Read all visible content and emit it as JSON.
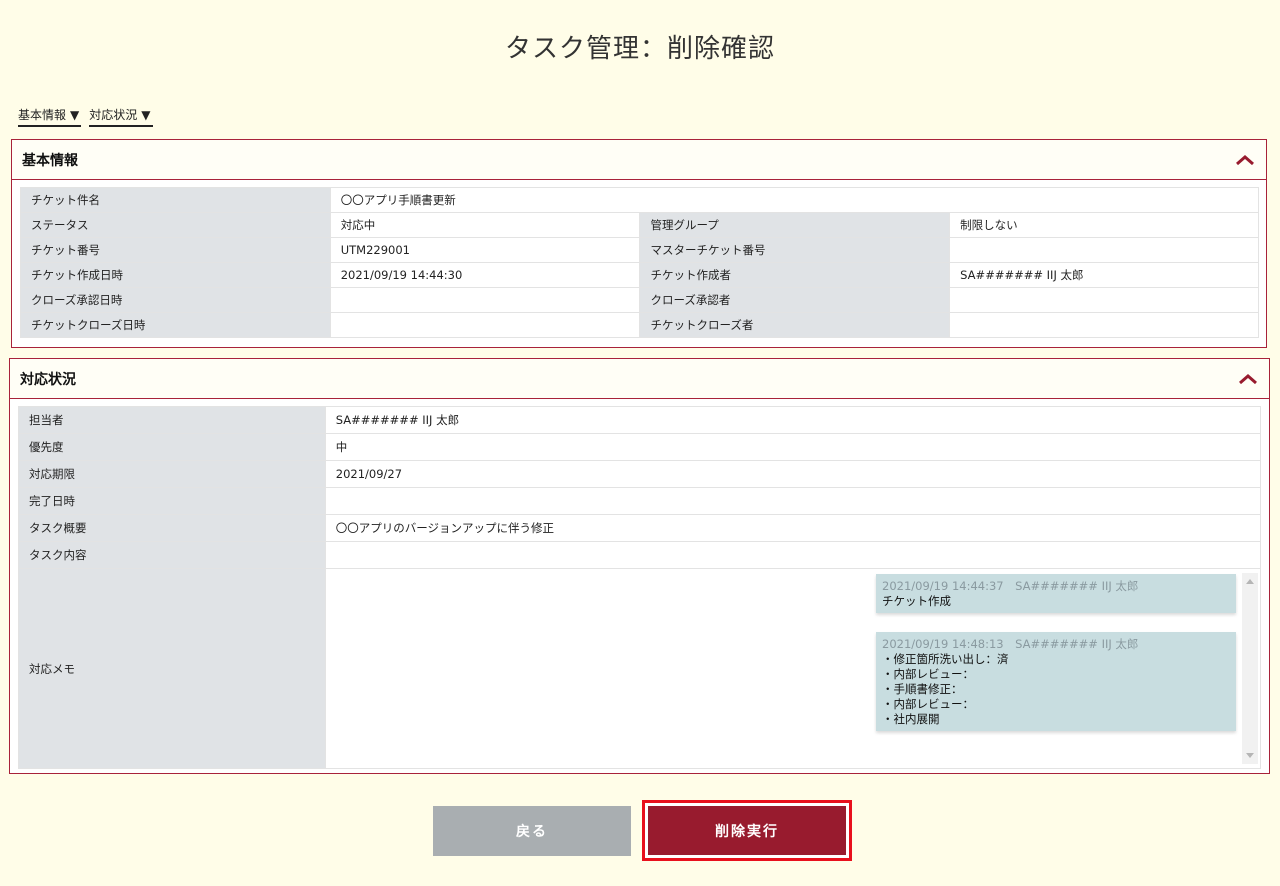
{
  "page": {
    "title": "タスク管理：削除確認"
  },
  "jump_links": [
    {
      "label": "基本情報",
      "arrow": "▼"
    },
    {
      "label": "対応状況",
      "arrow": "▼"
    }
  ],
  "basic_info": {
    "title": "基本情報",
    "ticket_name_label": "チケット件名",
    "ticket_name_value": "〇〇アプリ手順書更新",
    "rows": [
      {
        "l1": "ステータス",
        "v1": "対応中",
        "l2": "管理グループ",
        "v2": "制限しない"
      },
      {
        "l1": "チケット番号",
        "v1": "UTM229001",
        "l2": "マスターチケット番号",
        "v2": ""
      },
      {
        "l1": "チケット作成日時",
        "v1": "2021/09/19 14:44:30",
        "l2": "チケット作成者",
        "v2": "SA####### IIJ 太郎"
      },
      {
        "l1": "クローズ承認日時",
        "v1": "",
        "l2": "クローズ承認者",
        "v2": ""
      },
      {
        "l1": "チケットクローズ日時",
        "v1": "",
        "l2": "チケットクローズ者",
        "v2": ""
      }
    ]
  },
  "status": {
    "title": "対応状況",
    "rows": [
      {
        "label": "担当者",
        "value": "SA####### IIJ 太郎"
      },
      {
        "label": "優先度",
        "value": "中"
      },
      {
        "label": "対応期限",
        "value": "2021/09/27"
      },
      {
        "label": "完了日時",
        "value": ""
      },
      {
        "label": "タスク概要",
        "value": "〇〇アプリのバージョンアップに伴う修正"
      },
      {
        "label": "タスク内容",
        "value": ""
      }
    ],
    "memo_label": "対応メモ",
    "memos": [
      {
        "meta": "2021/09/19 14:44:37　SA####### IIJ 太郎",
        "lines": [
          "チケット作成"
        ]
      },
      {
        "meta": "2021/09/19 14:48:13　SA####### IIJ 太郎",
        "lines": [
          "・修正箇所洗い出し：済",
          "・内部レビュー：",
          "・手順書修正：",
          "・内部レビュー：",
          "・社内展開"
        ]
      }
    ]
  },
  "buttons": {
    "back": "戻る",
    "delete": "削除実行"
  },
  "colors": {
    "accent": "#981b2e",
    "border": "#a8223a",
    "background": "#fffde8",
    "memo_bg": "#c8dde0"
  }
}
